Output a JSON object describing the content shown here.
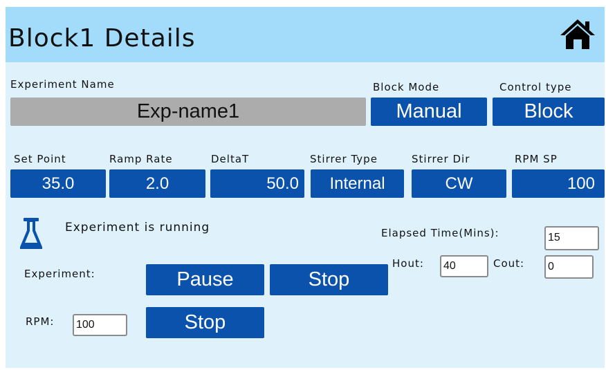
{
  "header": {
    "title": "Block1 Details",
    "home_icon": "home-icon"
  },
  "experiment_name": {
    "label": "Experiment Name",
    "value": "Exp-name1"
  },
  "block_mode": {
    "label": "Block Mode",
    "value": "Manual"
  },
  "control_type": {
    "label": "Control type",
    "value": "Block"
  },
  "params": [
    {
      "label": "Set Point",
      "value": "35.0"
    },
    {
      "label": "Ramp Rate",
      "value": "2.0"
    },
    {
      "label": "DeltaT",
      "value": "50.0"
    },
    {
      "label": "Stirrer Type",
      "value": "Internal"
    },
    {
      "label": "Stirrer Dir",
      "value": "CW"
    },
    {
      "label": "RPM SP",
      "value": "100"
    }
  ],
  "status": {
    "icon": "flask-icon",
    "text": "Experiment is running"
  },
  "elapsed": {
    "label": "Elapsed Time(Mins):",
    "value": "15"
  },
  "hout": {
    "label": "Hout:",
    "value": "40"
  },
  "cout": {
    "label": "Cout:",
    "value": "0"
  },
  "experiment_controls": {
    "label": "Experiment:",
    "pause": "Pause",
    "stop": "Stop"
  },
  "rpm_controls": {
    "label": "RPM:",
    "value": "100",
    "stop": "Stop"
  },
  "colors": {
    "header_bg": "#a3dcfa",
    "panel_bg": "#dff2fc",
    "button_bg": "#0b52ad",
    "name_field_bg": "#acacac"
  }
}
